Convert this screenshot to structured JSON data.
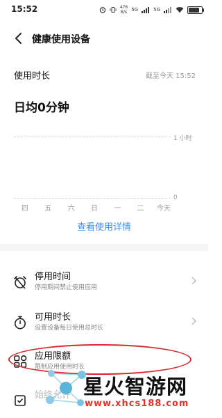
{
  "status_bar": {
    "time": "15:52",
    "icons": [
      "alarm-icon",
      "vibrate-icon",
      "data-speed-icon",
      "signal-icon",
      "signal-icon",
      "wifi-icon",
      "battery-icon"
    ],
    "data_speed_top": "476",
    "data_speed_bottom": "B/s",
    "net1": "5G",
    "net2": "5G",
    "battery_level": 0.85
  },
  "header": {
    "title": "健康使用设备"
  },
  "usage": {
    "label": "使用时长",
    "as_of": "截至今天 15:52",
    "daily_average": "日均0分钟"
  },
  "chart_data": {
    "type": "bar",
    "categories": [
      "四",
      "五",
      "六",
      "日",
      "一",
      "二",
      "今天"
    ],
    "values": [
      0,
      0,
      0,
      0,
      0,
      0,
      0
    ],
    "y_tick_labels": [
      "1 小时",
      "0"
    ],
    "grid": true
  },
  "detail_link": "查看使用详情",
  "settings": [
    {
      "title": "停用时间",
      "subtitle": "停用期间禁止使用应用",
      "icon": "alarm-off-icon"
    },
    {
      "title": "可用时长",
      "subtitle": "设置设备每日使用总时长",
      "icon": "stopwatch-icon"
    },
    {
      "title": "应用限额",
      "subtitle": "限制应用使用时长",
      "icon": "apps-grid-icon"
    },
    {
      "title": "始终允许",
      "subtitle": "",
      "icon": "checkbox-icon"
    }
  ],
  "watermark": {
    "title": "星火智游网",
    "url": "www.xhcs188.com",
    "accent": "#e4322b"
  },
  "colors": {
    "accent": "#3c8df2",
    "highlight": "#d42a2a"
  }
}
